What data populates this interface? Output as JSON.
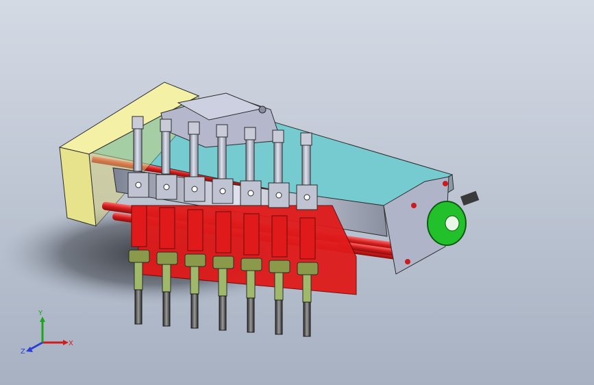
{
  "viewport": {
    "background_top": "#d4dae4",
    "background_bottom": "#a7b1c2"
  },
  "model": {
    "colors": {
      "end_block_yellow": "#e7e28c",
      "base_plate_cyan": "#75cbcf",
      "housing_gray": "#b5b8cc",
      "grip_red": "#e01a1a",
      "rod_red": "#d72020",
      "nut_olive": "#8a9a4a",
      "shaft_green": "#9fb86a",
      "wheel_green": "#22c02a",
      "cylinder_gray": "#b9bfd0"
    },
    "nozzle_count": 7
  },
  "triad": {
    "x_label": "X",
    "y_label": "Y",
    "z_label": "Z",
    "x_color": "#d01c1c",
    "y_color": "#1aa61a",
    "z_color": "#2a3fd6"
  }
}
